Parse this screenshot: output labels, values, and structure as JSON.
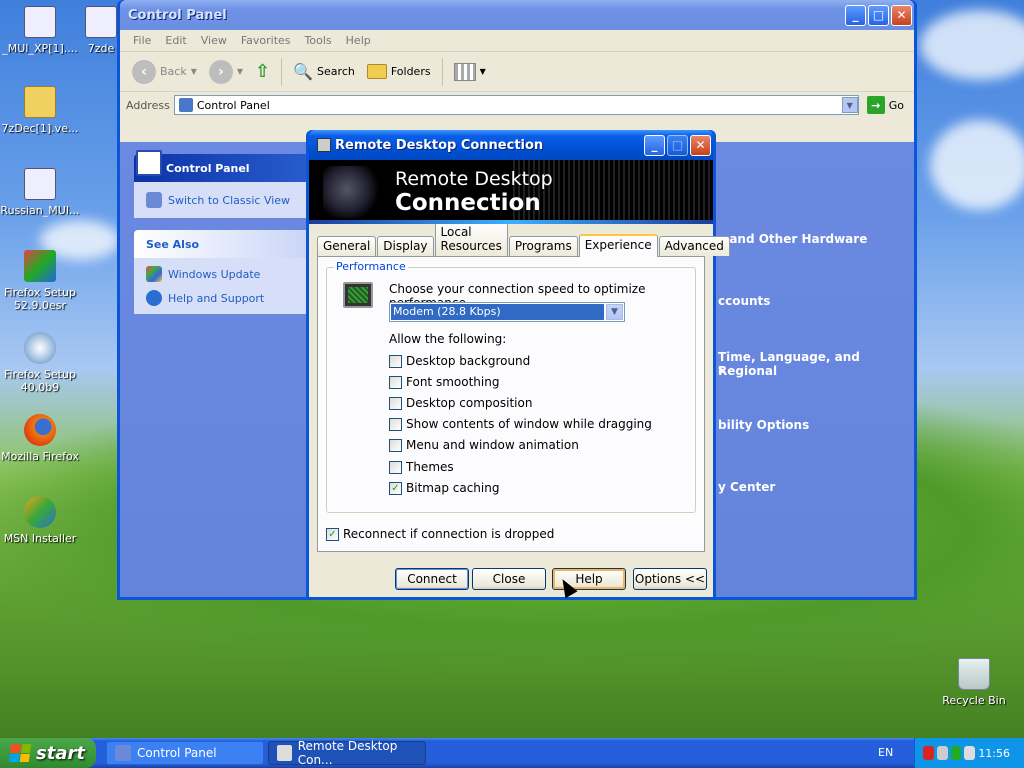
{
  "desktop": {
    "icons": [
      {
        "label": "_MUI_XP[1]...."
      },
      {
        "label": "7zde"
      },
      {
        "label": "7zDec[1].ve..."
      },
      {
        "label": "Russian_MUI..."
      },
      {
        "label": "Firefox Setup 52.9.0esr"
      },
      {
        "label": "Firefox Setup 40.0b9"
      },
      {
        "label": "Mozilla Firefox"
      },
      {
        "label": "MSN Installer"
      },
      {
        "label": "Recycle Bin"
      }
    ]
  },
  "cp": {
    "title": "Control Panel",
    "menu": [
      "File",
      "Edit",
      "View",
      "Favorites",
      "Tools",
      "Help"
    ],
    "toolbar": {
      "back": "Back",
      "search": "Search",
      "folders": "Folders"
    },
    "address_label": "Address",
    "address_value": "Control Panel",
    "go": "Go",
    "taskpane": {
      "primary_title": "Control Panel",
      "switch_view": "Switch to Classic View",
      "see_also": "See Also",
      "windows_update": "Windows Update",
      "help_support": "Help and Support"
    },
    "categories": [
      "s and Other Hardware",
      "ccounts",
      "Time, Language, and Regional",
      "s",
      "bility Options",
      "y Center"
    ]
  },
  "rdp": {
    "title": "Remote Desktop Connection",
    "banner_line1": "Remote Desktop",
    "banner_line2": "Connection",
    "tabs": [
      "General",
      "Display",
      "Local Resources",
      "Programs",
      "Experience",
      "Advanced"
    ],
    "group_title": "Performance",
    "choose_text": "Choose your connection speed to optimize performance.",
    "speed_value": "Modem (28.8 Kbps)",
    "allow_text": "Allow the following:",
    "options": [
      {
        "label": "Desktop background",
        "checked": false
      },
      {
        "label": "Font smoothing",
        "checked": false
      },
      {
        "label": "Desktop composition",
        "checked": false
      },
      {
        "label": "Show contents of window while dragging",
        "checked": false
      },
      {
        "label": "Menu and window animation",
        "checked": false
      },
      {
        "label": "Themes",
        "checked": false
      },
      {
        "label": "Bitmap caching",
        "checked": true
      }
    ],
    "reconnect": "Reconnect if connection is dropped",
    "reconnect_checked": true,
    "buttons": {
      "connect": "Connect",
      "close": "Close",
      "help": "Help",
      "options": "Options <<"
    }
  },
  "taskbar": {
    "start": "start",
    "tasks": [
      "Control Panel",
      "Remote Desktop Con..."
    ],
    "lang": "EN",
    "clock": "11:56"
  },
  "colors": {
    "accent": "#0a55d8",
    "selection": "#316ac5",
    "start_green": "#3c9a3c"
  }
}
